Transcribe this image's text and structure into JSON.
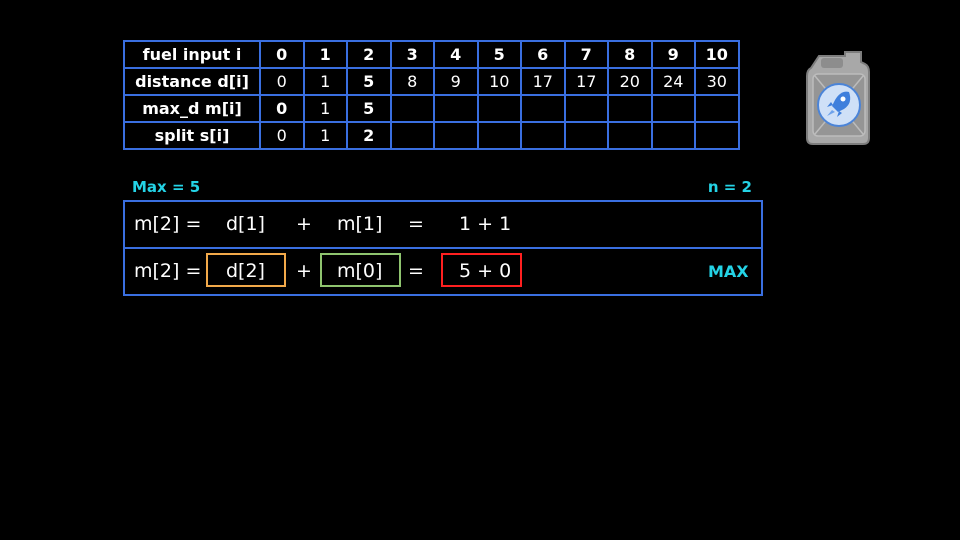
{
  "table": {
    "rows": [
      {
        "header": "fuel input i",
        "cells": [
          "0",
          "1",
          "2",
          "3",
          "4",
          "5",
          "6",
          "7",
          "8",
          "9",
          "10"
        ]
      },
      {
        "header": "distance d[i]",
        "cells": [
          "0",
          "1",
          "5",
          "8",
          "9",
          "10",
          "17",
          "17",
          "20",
          "24",
          "30"
        ]
      },
      {
        "header": "max_d m[i]",
        "cells": [
          "0",
          "1",
          "5",
          "",
          "",
          "",
          "",
          "",
          "",
          "",
          ""
        ]
      },
      {
        "header": "split s[i]",
        "cells": [
          "0",
          "1",
          "2",
          "",
          "",
          "",
          "",
          "",
          "",
          "",
          ""
        ]
      }
    ],
    "highlight_colors": {
      "distance_2": "#f2a94a",
      "max_0": "#8fc46f",
      "max_2": "#ff2020",
      "split_2": "#c9c9c9"
    }
  },
  "labels": {
    "max": "Max = 5",
    "n": "n = 2"
  },
  "equations": {
    "row1": {
      "lhs": "m[2] =",
      "d": "d[1]",
      "plus": "+",
      "m": "m[1]",
      "eq": "=",
      "result": "1 + 1"
    },
    "row2": {
      "lhs": "m[2] =",
      "d": "d[2]",
      "plus": "+",
      "m": "m[0]",
      "eq": "=",
      "result": "5 + 0",
      "tag": "MAX"
    }
  },
  "colors": {
    "accent_blue": "#3a6fe0",
    "cyan": "#24d3e6",
    "orange": "#f2a94a",
    "green": "#8fc46f",
    "red": "#ff2020"
  },
  "icon": "jerrycan-rocket-icon"
}
